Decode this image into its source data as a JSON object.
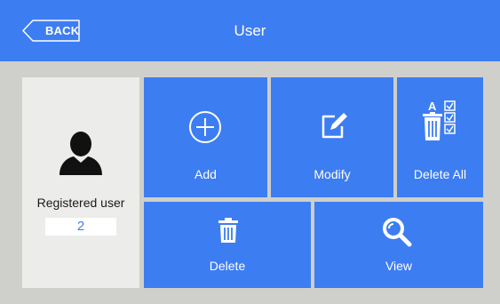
{
  "header": {
    "back_label": "BACK",
    "title": "User"
  },
  "registered": {
    "label": "Registered user",
    "count": "2"
  },
  "tiles": {
    "add": {
      "label": "Add",
      "icon": "plus-circle-icon"
    },
    "modify": {
      "label": "Modify",
      "icon": "edit-icon"
    },
    "delete_all": {
      "label": "Delete All",
      "icon": "delete-all-icon",
      "icon_glyph": "A"
    },
    "delete": {
      "label": "Delete",
      "icon": "trash-icon"
    },
    "view": {
      "label": "View",
      "icon": "search-icon"
    }
  },
  "colors": {
    "accent": "#3d7df2",
    "background": "#cfcfcb",
    "panel": "#ececea"
  }
}
